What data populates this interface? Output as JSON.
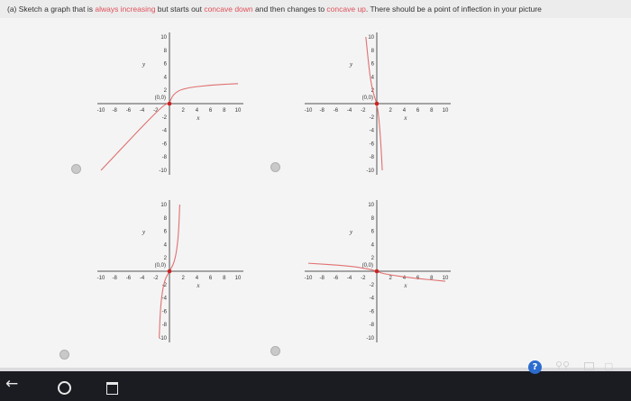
{
  "prompt": {
    "part": "(a)",
    "t1": "Sketch a graph that is ",
    "always_increasing": "always increasing",
    "t2": " but starts out ",
    "concave_down": "concave down",
    "t3": " and then changes to ",
    "concave_up": "concave up",
    "t4": ". There should be a point of inflection in your picture"
  },
  "colors": {
    "curve": "#e07070",
    "axis": "#555555",
    "point": "#cc2222",
    "emphasis": "#e0505a"
  },
  "graphs": [
    {
      "name": "option-a",
      "y_label": "y",
      "x_label": "x",
      "origin_label": "(0,0)",
      "x_ticks": [
        "-10",
        "-8",
        "-6",
        "-4",
        "-2",
        "2",
        "4",
        "6",
        "8",
        "10"
      ],
      "y_ticks": [
        "10",
        "8",
        "6",
        "4",
        "2",
        "-2",
        "-4",
        "-6",
        "-8",
        "-10"
      ],
      "xlim": [
        -10,
        10
      ],
      "ylim": [
        -10,
        10
      ],
      "curve": [
        [
          -10,
          -10
        ],
        [
          -1,
          -0.2
        ],
        [
          0,
          0
        ],
        [
          0.5,
          1.4
        ],
        [
          2,
          2.3
        ],
        [
          6,
          2.8
        ],
        [
          10,
          3
        ]
      ]
    },
    {
      "name": "option-b",
      "y_label": "y",
      "x_label": "x",
      "origin_label": "(0,0)",
      "x_ticks": [
        "-10",
        "-8",
        "-6",
        "-4",
        "-2",
        "2",
        "4",
        "6",
        "8",
        "10"
      ],
      "y_ticks": [
        "10",
        "8",
        "6",
        "4",
        "2",
        "-2",
        "-4",
        "-6",
        "-8",
        "-10"
      ],
      "xlim": [
        -10,
        10
      ],
      "ylim": [
        -10,
        10
      ],
      "curve": [
        [
          -1.6,
          10
        ],
        [
          -1,
          4
        ],
        [
          -0.5,
          1.5
        ],
        [
          0,
          0
        ],
        [
          0.3,
          -2
        ],
        [
          0.6,
          -6
        ],
        [
          0.8,
          -10
        ]
      ]
    },
    {
      "name": "option-c",
      "y_label": "y",
      "x_label": "x",
      "origin_label": "(0,0)",
      "x_ticks": [
        "-10",
        "-8",
        "-6",
        "-4",
        "-2",
        "2",
        "4",
        "6",
        "8",
        "10"
      ],
      "y_ticks": [
        "10",
        "8",
        "6",
        "4",
        "2",
        "-2",
        "-4",
        "-6",
        "-8",
        "-10"
      ],
      "xlim": [
        -10,
        10
      ],
      "ylim": [
        -10,
        10
      ],
      "curve": [
        [
          -1.5,
          -10
        ],
        [
          -1.3,
          -5
        ],
        [
          -0.8,
          -1.5
        ],
        [
          0,
          0
        ],
        [
          0.8,
          1.5
        ],
        [
          1.3,
          5
        ],
        [
          1.5,
          10
        ]
      ]
    },
    {
      "name": "option-d",
      "y_label": "y",
      "x_label": "x",
      "origin_label": "(0,0)",
      "x_ticks": [
        "-10",
        "-8",
        "-6",
        "-4",
        "-2",
        "2",
        "4",
        "6",
        "8",
        "10"
      ],
      "y_ticks": [
        "10",
        "8",
        "6",
        "4",
        "2",
        "-2",
        "-4",
        "-6",
        "-8",
        "-10"
      ],
      "xlim": [
        -10,
        10
      ],
      "ylim": [
        -10,
        10
      ],
      "curve": [
        [
          -10,
          1.2
        ],
        [
          -4,
          0.8
        ],
        [
          -1,
          0.3
        ],
        [
          0,
          0
        ],
        [
          1,
          -0.4
        ],
        [
          5,
          -1
        ],
        [
          10,
          -1.5
        ]
      ]
    }
  ],
  "taskbar": {
    "back_icon": "back-arrow-icon",
    "cortana_icon": "cortana-ring-icon",
    "taskview_icon": "task-view-icon",
    "help_icon": "help-icon",
    "people_icon": "people-icon",
    "notification_icon": "notification-icon"
  }
}
